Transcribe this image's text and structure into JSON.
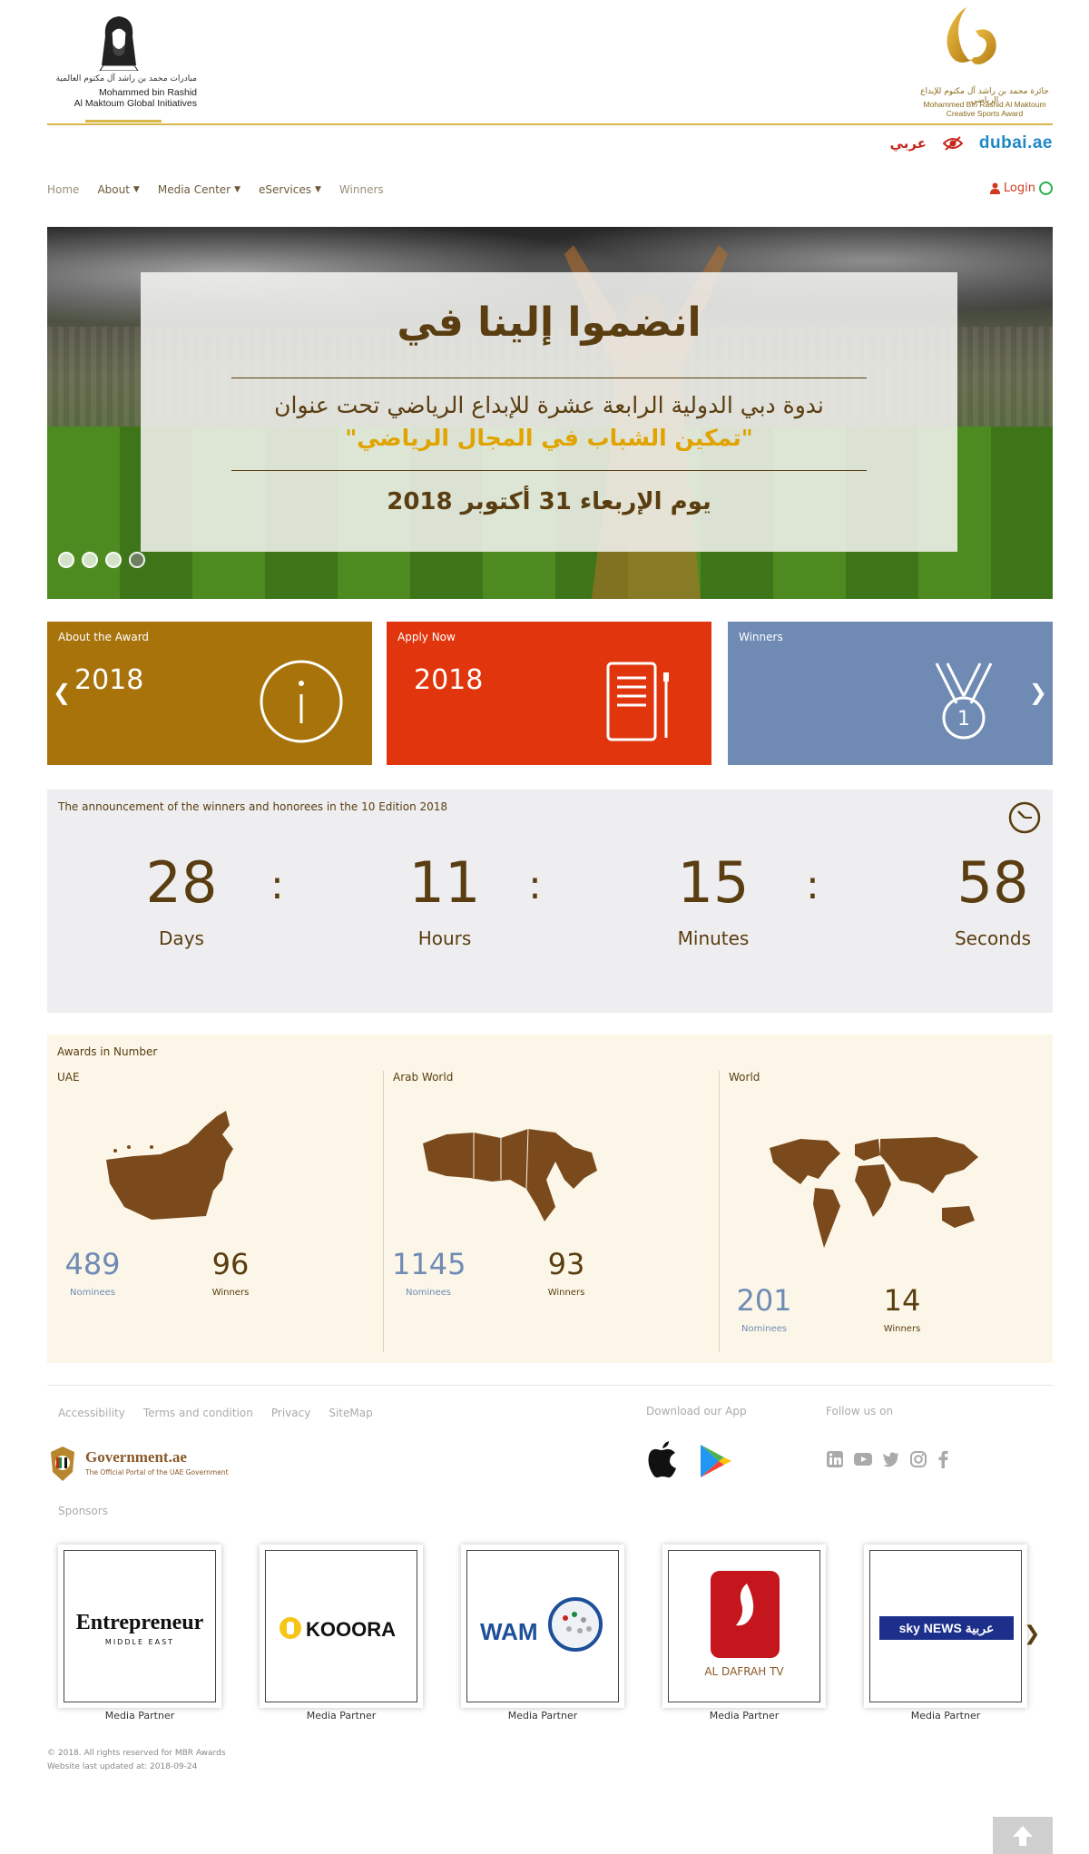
{
  "header": {
    "left_logo_ar": "مبادرات محمد بن راشد آل مكتوم العالمية",
    "left_logo_en_1": "Mohammed bin Rashid",
    "left_logo_en_2": "Al Maktoum Global Initiatives",
    "right_logo_ar": "جائزة محمد بن راشد آل مكتوم للإبداع الرياضي",
    "right_logo_en_1": "Mohammed Bin Rashid Al Maktoum",
    "right_logo_en_2": "Creative Sports Award",
    "lang_arabic": "عربي",
    "dubai_brand": "dubai.ae"
  },
  "nav": {
    "items": [
      {
        "label": "Home",
        "dropdown": false
      },
      {
        "label": "About",
        "dropdown": true
      },
      {
        "label": "Media Center",
        "dropdown": true
      },
      {
        "label": "eServices",
        "dropdown": true
      },
      {
        "label": "Winners",
        "dropdown": false
      }
    ],
    "login": "Login"
  },
  "hero": {
    "headline": "انضموا إلينا في",
    "line1": "ندوة دبي الدولية الرابعة عشرة للإبداع الرياضي تحت عنوان",
    "line2": "\"تمكين الشباب في المجال الرياضي\"",
    "date": "يوم الإربعاء 31 أكتوبر 2018",
    "slides": 4,
    "active_slide": 4
  },
  "tiles": {
    "about": {
      "title": "About the Award",
      "year": "2018",
      "color": "#a8730b"
    },
    "apply": {
      "title": "Apply Now",
      "year": "2018",
      "color": "#e1360d"
    },
    "winners": {
      "title": "Winners",
      "color": "#6f8bb4"
    }
  },
  "countdown": {
    "title": "The announcement of the winners and honorees in the 10 Edition 2018",
    "days": "28",
    "days_label": "Days",
    "hours": "11",
    "hours_label": "Hours",
    "minutes": "15",
    "minutes_label": "Minutes",
    "seconds": "58",
    "seconds_label": "Seconds"
  },
  "awards": {
    "title": "Awards in Number",
    "regions": [
      {
        "name": "UAE",
        "nominees": "489",
        "nominees_label": "Nominees",
        "winners": "96",
        "winners_label": "Winners"
      },
      {
        "name": "Arab World",
        "nominees": "1145",
        "nominees_label": "Nominees",
        "winners": "93",
        "winners_label": "Winners"
      },
      {
        "name": "World",
        "nominees": "201",
        "nominees_label": "Nominees",
        "winners": "14",
        "winners_label": "Winners"
      }
    ]
  },
  "footer": {
    "links": [
      "Accessibility",
      "Terms and condition",
      "Privacy",
      "SiteMap"
    ],
    "gov_title": "Government.ae",
    "gov_sub": "The Official Portal of the UAE Government",
    "download_title": "Download our App",
    "follow_title": "Follow us on",
    "sponsors_title": "Sponsors",
    "sponsors": [
      {
        "name": "Entrepreneur",
        "sub": "MIDDLE EAST",
        "caption": "Media Partner"
      },
      {
        "name": "KOOORA",
        "caption": "Media Partner"
      },
      {
        "name": "WAM",
        "caption": "Media Partner"
      },
      {
        "name": "AL DAFRAH TV",
        "caption": "Media Partner"
      },
      {
        "name": "sky NEWS عربية",
        "caption": "Media Partner"
      }
    ],
    "copyright": "© 2018. All rights reserved for MBR Awards",
    "updated": "Website last updated at: 2018-09-24"
  }
}
